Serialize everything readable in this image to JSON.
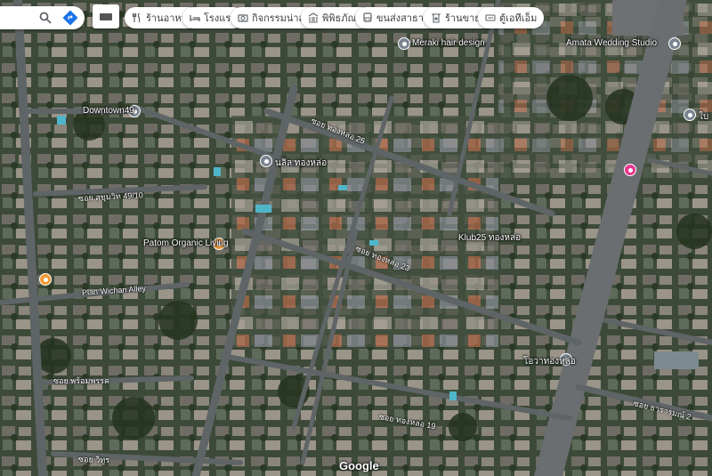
{
  "chips": [
    {
      "label": "ร้านอาหาร",
      "icon": "fork-knife-icon"
    },
    {
      "label": "โรงแรม",
      "icon": "bed-icon"
    },
    {
      "label": "กิจกรรมน่าสนใจ",
      "icon": "camera-icon"
    },
    {
      "label": "พิพิธภัณฑ์",
      "icon": "museum-icon"
    },
    {
      "label": "ขนส่งสาธารณะ",
      "icon": "bus-icon"
    },
    {
      "label": "ร้านขายยา",
      "icon": "pharmacy-icon"
    },
    {
      "label": "ตู้เอทีเอ็ม",
      "icon": "atm-icon"
    }
  ],
  "places": [
    {
      "label": "Meraki hair design",
      "pin_color": "#7b8591"
    },
    {
      "label": "Amata Wedding Studio",
      "pin_color": "#7b8591"
    },
    {
      "label": "Downtown49",
      "pin_color": "#7b8591"
    },
    {
      "label": "นลิล ทองหล่อ",
      "pin_color": "#7b8591"
    },
    {
      "label": "Klub25 ทองหล่อ",
      "pin_color": "#7b8591"
    },
    {
      "label": "Patom Organic Living",
      "pin_color": "#f29b35"
    },
    {
      "label": "โอวาทองหล่อ",
      "pin_color": "#7b8591"
    },
    {
      "label": "ใบ",
      "pin_color": "#7b8591"
    },
    {
      "label": "",
      "pin_color": "#e8348b"
    },
    {
      "label": "",
      "pin_color": "#f29b35"
    }
  ],
  "roads": [
    "ซอย ทองหล่อ 25",
    "ซอย ทองหล่อ 23",
    "ซอย สุขุมวิท 49/10",
    "Plan Wichan Alley",
    "ซอย พร้อมพรรค",
    "ซอย ธารารมณ์ 2",
    "ซอย ทองหล่อ 19",
    "ซอย วิทูร"
  ],
  "attribution": "Google",
  "colors": {
    "chip_bg": "#ffffff",
    "chip_text": "#3c4043",
    "search_blue": "#1a73e8"
  }
}
